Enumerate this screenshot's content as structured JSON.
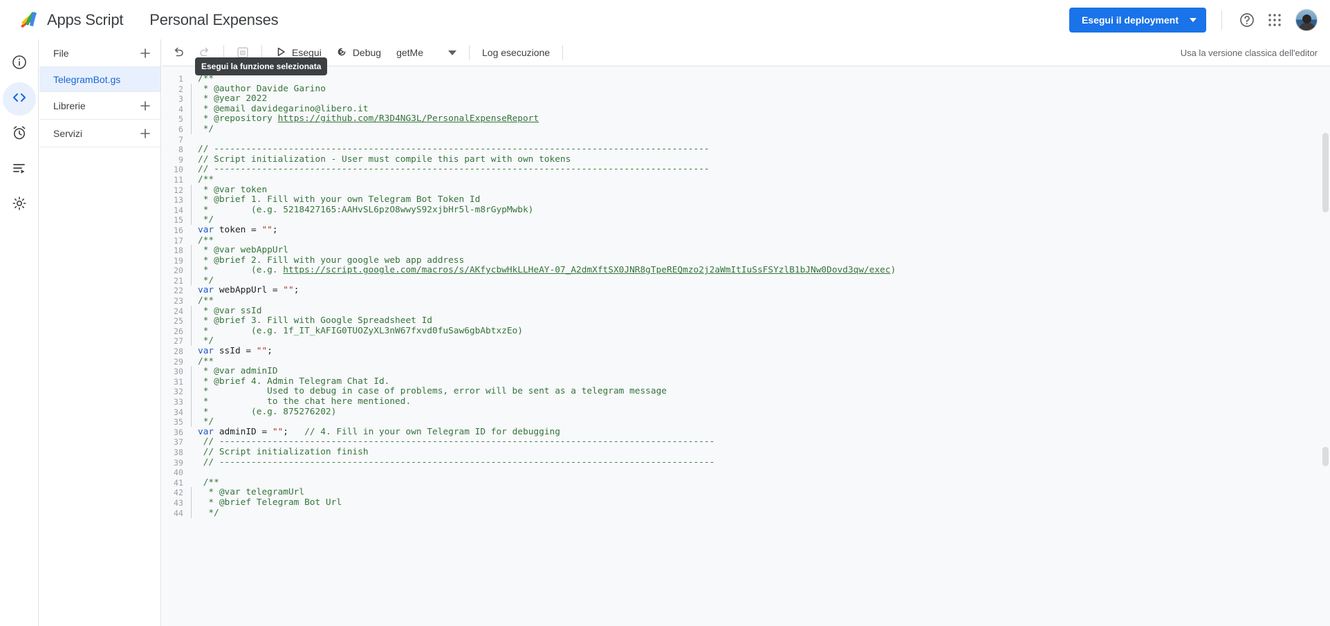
{
  "header": {
    "logo_icon": "apps-script-logo",
    "app_name": "Apps Script",
    "project_title": "Personal Expenses",
    "deploy_label": "Esegui il deployment",
    "deploy_caret_icon": "chevron-down-icon",
    "help_icon": "help-circle-icon",
    "apps_icon": "google-apps-grid-icon",
    "avatar_icon": "user-avatar",
    "accent_color": "#1a73e8"
  },
  "rail": {
    "items": [
      {
        "name": "overview",
        "icon": "info-circle-icon",
        "active": false
      },
      {
        "name": "editor",
        "icon": "code-brackets-icon",
        "active": true
      },
      {
        "name": "triggers",
        "icon": "alarm-clock-icon",
        "active": false
      },
      {
        "name": "executions",
        "icon": "executions-list-icon",
        "active": false
      },
      {
        "name": "settings",
        "icon": "gear-icon",
        "active": false
      }
    ]
  },
  "file_panel": {
    "files_label": "File",
    "files_add_icon": "plus-icon",
    "files": [
      {
        "label": "TelegramBot.gs",
        "selected": true
      }
    ],
    "libraries_label": "Librerie",
    "libraries_add_icon": "plus-icon",
    "services_label": "Servizi",
    "services_add_icon": "plus-icon"
  },
  "toolbar": {
    "add_icon": "plus-icon",
    "undo_icon": "undo-icon",
    "redo_icon": "redo-icon",
    "save_icon": "save-disk-icon",
    "run_label": "Esegui",
    "run_icon": "play-triangle-icon",
    "debug_label": "Debug",
    "debug_icon": "debug-icon",
    "selected_function": "getMe",
    "function_caret_icon": "chevron-down-icon",
    "execution_log_label": "Log esecuzione",
    "classic_editor_label": "Usa la versione classica dell'editor"
  },
  "tooltip": {
    "text": "Esegui la funzione selezionata"
  },
  "editor": {
    "lines": [
      {
        "n": 1,
        "fold": false,
        "tokens": [
          {
            "t": "cm",
            "s": "/**"
          }
        ]
      },
      {
        "n": 2,
        "fold": true,
        "tokens": [
          {
            "t": "cm",
            "s": " * @author Davide Garino"
          }
        ]
      },
      {
        "n": 3,
        "fold": true,
        "tokens": [
          {
            "t": "cm",
            "s": " * @year 2022"
          }
        ]
      },
      {
        "n": 4,
        "fold": true,
        "tokens": [
          {
            "t": "cm",
            "s": " * @email davidegarino@libero.it"
          }
        ]
      },
      {
        "n": 5,
        "fold": true,
        "tokens": [
          {
            "t": "cm",
            "s": " * @repository "
          },
          {
            "t": "lnk",
            "s": "https://github.com/R3D4NG3L/PersonalExpenseReport"
          }
        ]
      },
      {
        "n": 6,
        "fold": true,
        "tokens": [
          {
            "t": "cm",
            "s": " */"
          }
        ]
      },
      {
        "n": 7,
        "fold": false,
        "tokens": [
          {
            "t": "cm",
            "s": ""
          }
        ]
      },
      {
        "n": 8,
        "fold": false,
        "tokens": [
          {
            "t": "cm",
            "s": "// ---------------------------------------------------------------------------------------------"
          }
        ]
      },
      {
        "n": 9,
        "fold": false,
        "tokens": [
          {
            "t": "cm",
            "s": "// Script initialization - User must compile this part with own tokens"
          }
        ]
      },
      {
        "n": 10,
        "fold": false,
        "tokens": [
          {
            "t": "cm",
            "s": "// ---------------------------------------------------------------------------------------------"
          }
        ]
      },
      {
        "n": 11,
        "fold": false,
        "tokens": [
          {
            "t": "cm",
            "s": "/**"
          }
        ]
      },
      {
        "n": 12,
        "fold": true,
        "tokens": [
          {
            "t": "cm",
            "s": " * @var token"
          }
        ]
      },
      {
        "n": 13,
        "fold": true,
        "tokens": [
          {
            "t": "cm",
            "s": " * @brief 1. Fill with your own Telegram Bot Token Id"
          }
        ]
      },
      {
        "n": 14,
        "fold": true,
        "tokens": [
          {
            "t": "cm",
            "s": " *        (e.g. 5218427165:AAHvSL6pzO8wwyS92xjbHr5l-m8rGypMwbk)"
          }
        ]
      },
      {
        "n": 15,
        "fold": true,
        "tokens": [
          {
            "t": "cm",
            "s": " */"
          }
        ]
      },
      {
        "n": 16,
        "fold": false,
        "tokens": [
          {
            "t": "kw",
            "s": "var"
          },
          {
            "t": "pl",
            "s": " token = "
          },
          {
            "t": "str",
            "s": "\"\""
          },
          {
            "t": "pl",
            "s": ";"
          }
        ]
      },
      {
        "n": 17,
        "fold": false,
        "tokens": [
          {
            "t": "cm",
            "s": "/**"
          }
        ]
      },
      {
        "n": 18,
        "fold": true,
        "tokens": [
          {
            "t": "cm",
            "s": " * @var webAppUrl"
          }
        ]
      },
      {
        "n": 19,
        "fold": true,
        "tokens": [
          {
            "t": "cm",
            "s": " * @brief 2. Fill with your google web app address"
          }
        ]
      },
      {
        "n": 20,
        "fold": true,
        "tokens": [
          {
            "t": "cm",
            "s": " *        (e.g. "
          },
          {
            "t": "lnk",
            "s": "https://script.google.com/macros/s/AKfycbwHkLLHeAY-07_A2dmXftSX0JNR8gTpeREQmzo2j2aWmItIuSsFSYzlB1bJNw0Dovd3qw/exec"
          },
          {
            "t": "cm",
            "s": ")"
          }
        ]
      },
      {
        "n": 21,
        "fold": true,
        "tokens": [
          {
            "t": "cm",
            "s": " */"
          }
        ]
      },
      {
        "n": 22,
        "fold": false,
        "tokens": [
          {
            "t": "kw",
            "s": "var"
          },
          {
            "t": "pl",
            "s": " webAppUrl = "
          },
          {
            "t": "str",
            "s": "\"\""
          },
          {
            "t": "pl",
            "s": ";"
          }
        ]
      },
      {
        "n": 23,
        "fold": false,
        "tokens": [
          {
            "t": "cm",
            "s": "/**"
          }
        ]
      },
      {
        "n": 24,
        "fold": true,
        "tokens": [
          {
            "t": "cm",
            "s": " * @var ssId"
          }
        ]
      },
      {
        "n": 25,
        "fold": true,
        "tokens": [
          {
            "t": "cm",
            "s": " * @brief 3. Fill with Google Spreadsheet Id"
          }
        ]
      },
      {
        "n": 26,
        "fold": true,
        "tokens": [
          {
            "t": "cm",
            "s": " *        (e.g. 1f_IT_kAFIG0TUOZyXL3nW67fxvd0fuSaw6gbAbtxzEo)"
          }
        ]
      },
      {
        "n": 27,
        "fold": true,
        "tokens": [
          {
            "t": "cm",
            "s": " */"
          }
        ]
      },
      {
        "n": 28,
        "fold": false,
        "tokens": [
          {
            "t": "kw",
            "s": "var"
          },
          {
            "t": "pl",
            "s": " ssId = "
          },
          {
            "t": "str",
            "s": "\"\""
          },
          {
            "t": "pl",
            "s": ";"
          }
        ]
      },
      {
        "n": 29,
        "fold": false,
        "tokens": [
          {
            "t": "cm",
            "s": "/**"
          }
        ]
      },
      {
        "n": 30,
        "fold": true,
        "tokens": [
          {
            "t": "cm",
            "s": " * @var adminID"
          }
        ]
      },
      {
        "n": 31,
        "fold": true,
        "tokens": [
          {
            "t": "cm",
            "s": " * @brief 4. Admin Telegram Chat Id."
          }
        ]
      },
      {
        "n": 32,
        "fold": true,
        "tokens": [
          {
            "t": "cm",
            "s": " *           Used to debug in case of problems, error will be sent as a telegram message"
          }
        ]
      },
      {
        "n": 33,
        "fold": true,
        "tokens": [
          {
            "t": "cm",
            "s": " *           to the chat here mentioned."
          }
        ]
      },
      {
        "n": 34,
        "fold": true,
        "tokens": [
          {
            "t": "cm",
            "s": " *        (e.g. 875276202)"
          }
        ]
      },
      {
        "n": 35,
        "fold": true,
        "tokens": [
          {
            "t": "cm",
            "s": " */"
          }
        ]
      },
      {
        "n": 36,
        "fold": false,
        "tokens": [
          {
            "t": "kw",
            "s": "var"
          },
          {
            "t": "pl",
            "s": " adminID = "
          },
          {
            "t": "str",
            "s": "\"\""
          },
          {
            "t": "pl",
            "s": ";   "
          },
          {
            "t": "cm",
            "s": "// 4. Fill in your own Telegram ID for debugging"
          }
        ]
      },
      {
        "n": 37,
        "fold": false,
        "tokens": [
          {
            "t": "cm",
            "s": " // ---------------------------------------------------------------------------------------------"
          }
        ]
      },
      {
        "n": 38,
        "fold": false,
        "tokens": [
          {
            "t": "cm",
            "s": " // Script initialization finish"
          }
        ]
      },
      {
        "n": 39,
        "fold": false,
        "tokens": [
          {
            "t": "cm",
            "s": " // ---------------------------------------------------------------------------------------------"
          }
        ]
      },
      {
        "n": 40,
        "fold": false,
        "tokens": [
          {
            "t": "cm",
            "s": ""
          }
        ]
      },
      {
        "n": 41,
        "fold": false,
        "tokens": [
          {
            "t": "cm",
            "s": " /**"
          }
        ]
      },
      {
        "n": 42,
        "fold": true,
        "tokens": [
          {
            "t": "cm",
            "s": "  * @var telegramUrl"
          }
        ]
      },
      {
        "n": 43,
        "fold": true,
        "tokens": [
          {
            "t": "cm",
            "s": "  * @brief Telegram Bot Url"
          }
        ]
      },
      {
        "n": 44,
        "fold": true,
        "tokens": [
          {
            "t": "cm",
            "s": "  */"
          }
        ]
      }
    ]
  }
}
